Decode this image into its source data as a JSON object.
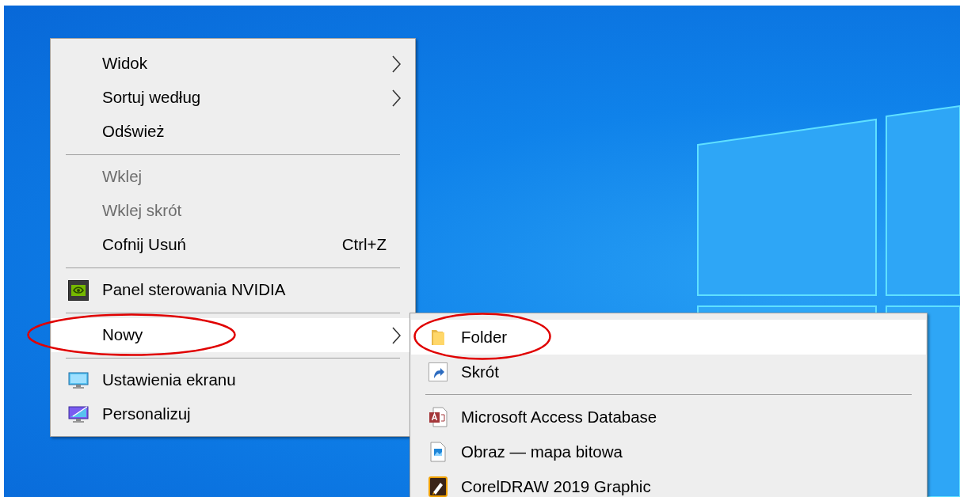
{
  "context_menu": {
    "items": [
      {
        "kind": "item",
        "label": "Widok",
        "submenu": true,
        "disabled": false,
        "selected": false,
        "circled": false
      },
      {
        "kind": "item",
        "label": "Sortuj według",
        "submenu": true,
        "disabled": false,
        "selected": false,
        "circled": false
      },
      {
        "kind": "item",
        "label": "Odśwież",
        "submenu": false,
        "disabled": false,
        "selected": false,
        "circled": false
      },
      {
        "kind": "separator"
      },
      {
        "kind": "item",
        "label": "Wklej",
        "submenu": false,
        "disabled": true,
        "selected": false,
        "circled": false
      },
      {
        "kind": "item",
        "label": "Wklej skrót",
        "submenu": false,
        "disabled": true,
        "selected": false,
        "circled": false
      },
      {
        "kind": "item",
        "label": "Cofnij Usuń",
        "shortcut": "Ctrl+Z",
        "submenu": false,
        "disabled": false,
        "selected": false,
        "circled": false
      },
      {
        "kind": "separator"
      },
      {
        "kind": "item",
        "label": "Panel sterowania NVIDIA",
        "submenu": false,
        "disabled": false,
        "selected": false,
        "circled": false
      },
      {
        "kind": "separator"
      },
      {
        "kind": "item",
        "label": "Nowy",
        "submenu": true,
        "disabled": false,
        "selected": true,
        "circled": true
      },
      {
        "kind": "separator"
      },
      {
        "kind": "item",
        "label": "Ustawienia ekranu",
        "submenu": false,
        "disabled": false,
        "selected": false,
        "circled": false
      },
      {
        "kind": "item",
        "label": "Personalizuj",
        "submenu": false,
        "disabled": false,
        "selected": false,
        "circled": false
      }
    ]
  },
  "submenu": {
    "items": [
      {
        "kind": "item",
        "label": "Folder",
        "submenu": false,
        "disabled": false,
        "selected": true,
        "circled": true
      },
      {
        "kind": "item",
        "label": "Skrót",
        "submenu": false,
        "disabled": false,
        "selected": false,
        "circled": false
      },
      {
        "kind": "separator"
      },
      {
        "kind": "item",
        "label": "Microsoft Access Database",
        "submenu": false,
        "disabled": false,
        "selected": false,
        "circled": false
      },
      {
        "kind": "item",
        "label": "Obraz — mapa bitowa",
        "submenu": false,
        "disabled": false,
        "selected": false,
        "circled": false
      },
      {
        "kind": "item",
        "label": "CorelDRAW 2019 Graphic",
        "submenu": false,
        "disabled": false,
        "selected": false,
        "circled": false
      }
    ]
  }
}
